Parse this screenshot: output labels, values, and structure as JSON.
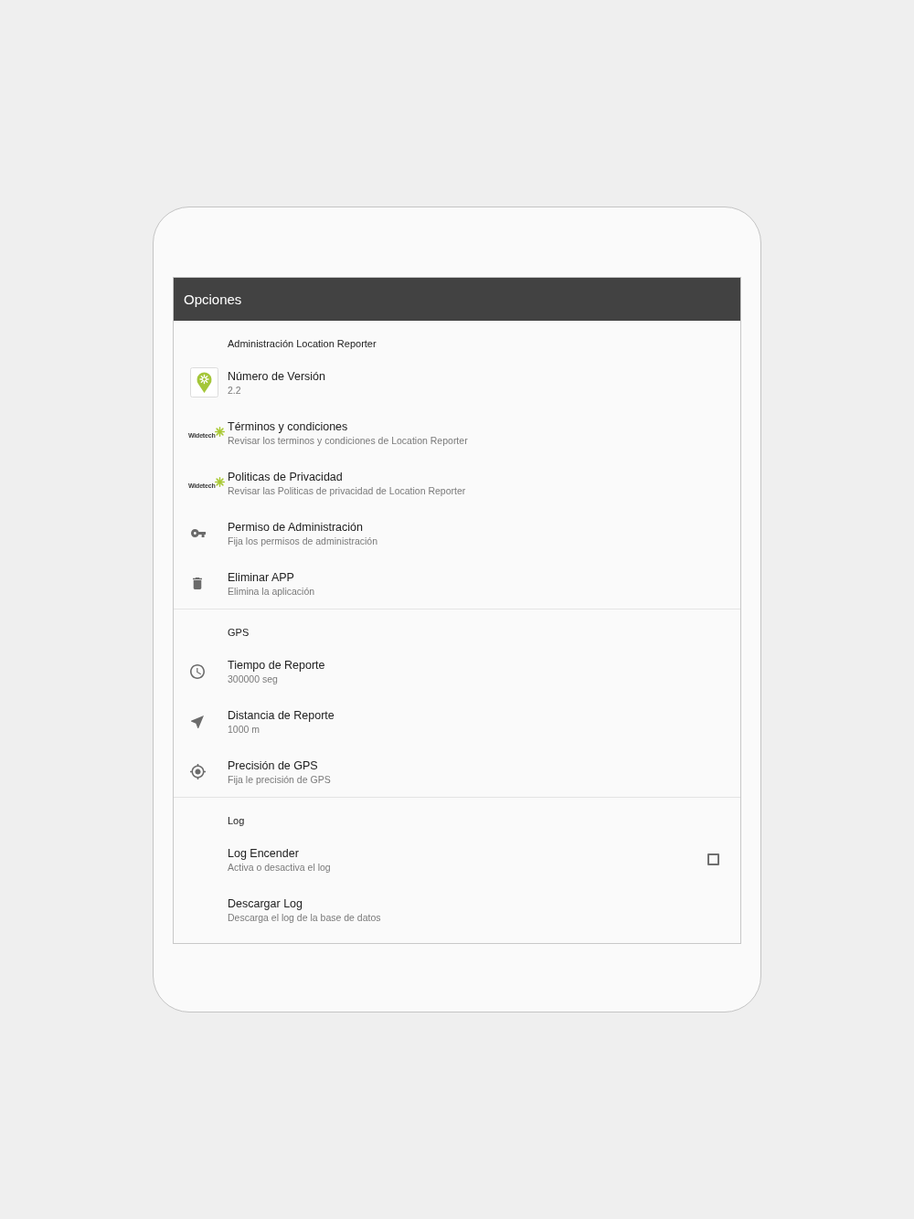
{
  "app_bar": {
    "title": "Opciones"
  },
  "sections": [
    {
      "header": "Administración Location Reporter",
      "items": [
        {
          "kind": "app-logo",
          "title": "Número de Versión",
          "summary": "2.2"
        },
        {
          "kind": "brand-logo",
          "logo_text": "Widetech",
          "title": "Términos y condiciones",
          "summary": "Revisar los terminos y condiciones de Location Reporter"
        },
        {
          "kind": "brand-logo",
          "logo_text": "Widetech",
          "title": "Politicas de Privacidad",
          "summary": "Revisar las Politicas de privacidad de Location Reporter"
        },
        {
          "kind": "key",
          "title": "Permiso de Administración",
          "summary": "Fija los permisos de administración"
        },
        {
          "kind": "trash",
          "title": "Eliminar APP",
          "summary": "Elimina la aplicación"
        }
      ]
    },
    {
      "header": "GPS",
      "items": [
        {
          "kind": "clock",
          "title": "Tiempo de Reporte",
          "summary": "300000 seg"
        },
        {
          "kind": "navigation",
          "title": "Distancia de Reporte",
          "summary": "1000 m"
        },
        {
          "kind": "gps",
          "title": "Precisión de GPS",
          "summary": "Fija le precisión de GPS"
        }
      ]
    },
    {
      "header": "Log",
      "items": [
        {
          "kind": "checkbox",
          "checked": false,
          "title": "Log Encender",
          "summary": "Activa o desactiva el log"
        },
        {
          "kind": "plain",
          "title": "Descargar Log",
          "summary": "Descarga el log de la base de datos"
        }
      ]
    }
  ]
}
